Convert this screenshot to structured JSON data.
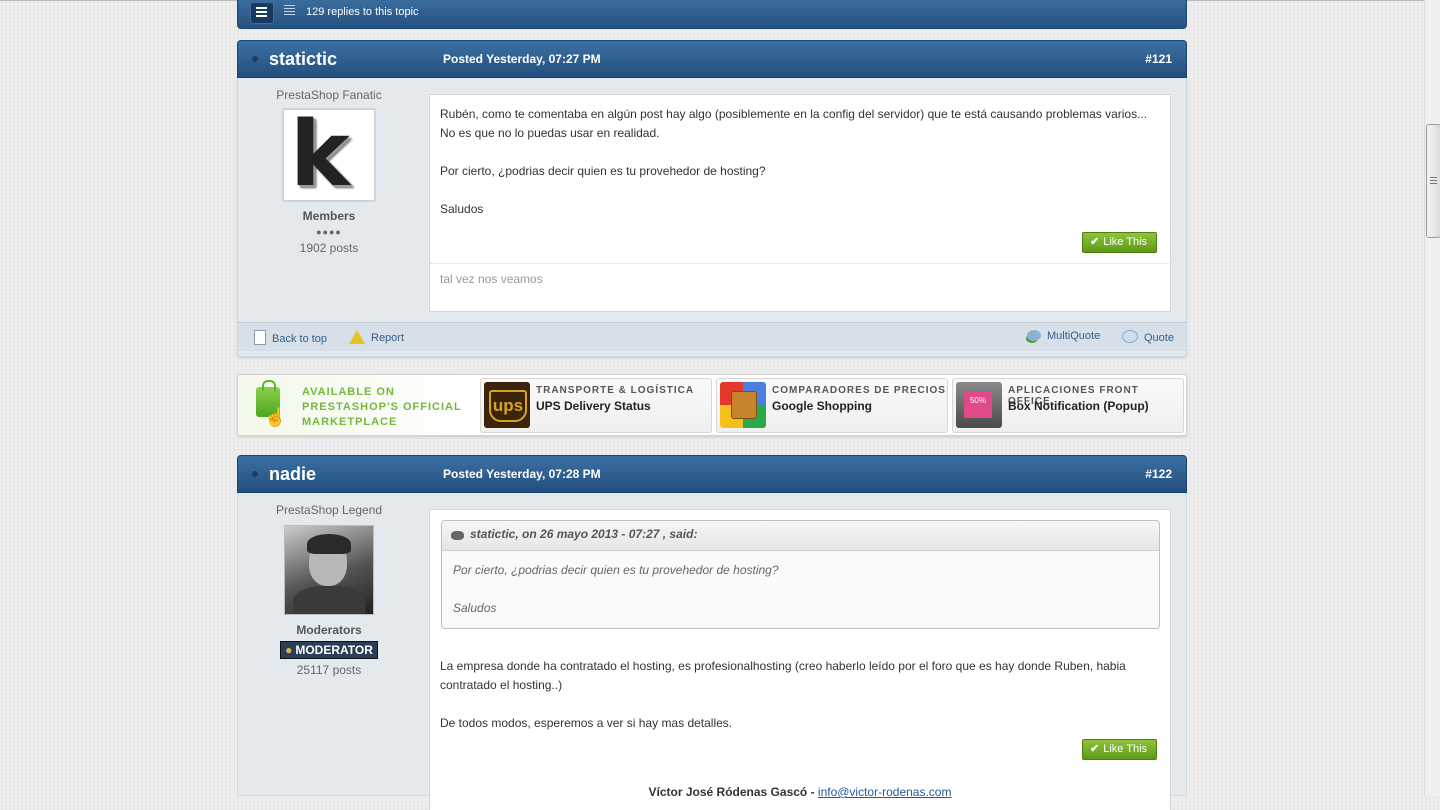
{
  "topic_bar": {
    "replies_text": "129 replies to this topic"
  },
  "posts": [
    {
      "author": "statictic",
      "posted": "Posted Yesterday, 07:27 PM",
      "number": "#121",
      "group_title": "PrestaShop Fanatic",
      "avatar_letter": "k",
      "member_group": "Members",
      "pips": "●●●●",
      "post_count": "1902 posts",
      "body": [
        "Rubén, como te comentaba en algún post hay algo (posiblemente en la config del servidor) que te está causando problemas varios... No es que no lo puedas usar en realidad.",
        "Por cierto, ¿podrias decir quien es tu provehedor de hosting?",
        "Saludos"
      ],
      "like_label": "Like This",
      "signature": "tal vez nos veamos"
    },
    {
      "author": "nadie",
      "posted": "Posted Yesterday, 07:28 PM",
      "number": "#122",
      "group_title": "PrestaShop Legend",
      "member_group": "Moderators",
      "badge": "MODERATOR",
      "post_count": "25117 posts",
      "quote": {
        "header": "statictic, on 26 mayo 2013 - 07:27 , said:",
        "lines": [
          "Por cierto, ¿podrias decir quien es tu provehedor de hosting?",
          "Saludos"
        ]
      },
      "body": [
        "La empresa donde ha contratado el hosting, es profesionalhosting (creo haberlo leído por el foro que es hay donde Ruben, habia contratado el hosting..)",
        "De todos modos, esperemos a ver si hay mas detalles."
      ],
      "like_label": "Like This",
      "signature_name": "Víctor José Ródenas Gascó - ",
      "signature_email": "info@victor-rodenas.com"
    }
  ],
  "post_footer": {
    "back_to_top": "Back to top",
    "report": "Report",
    "multiquote": "MultiQuote",
    "quote": "Quote"
  },
  "marketplace": {
    "intro_lines": [
      "AVAILABLE ON",
      "PRESTASHOP'S OFFICIAL",
      "MARKETPLACE"
    ],
    "cards": [
      {
        "category": "TRANSPORTE & LOGÍSTICA",
        "name": "UPS Delivery Status",
        "icon": "ups-logo"
      },
      {
        "category": "COMPARADORES DE PRECIOS",
        "name": "Google Shopping",
        "icon": "google-shopping-logo"
      },
      {
        "category": "APLICACIONES FRONT OFFICE",
        "name": "Box Notification (Popup)",
        "icon": "box-notification-logo"
      }
    ]
  },
  "colors": {
    "header_blue": "#2c5d8f",
    "like_green": "#6aa820",
    "link_blue": "#335f8c"
  }
}
